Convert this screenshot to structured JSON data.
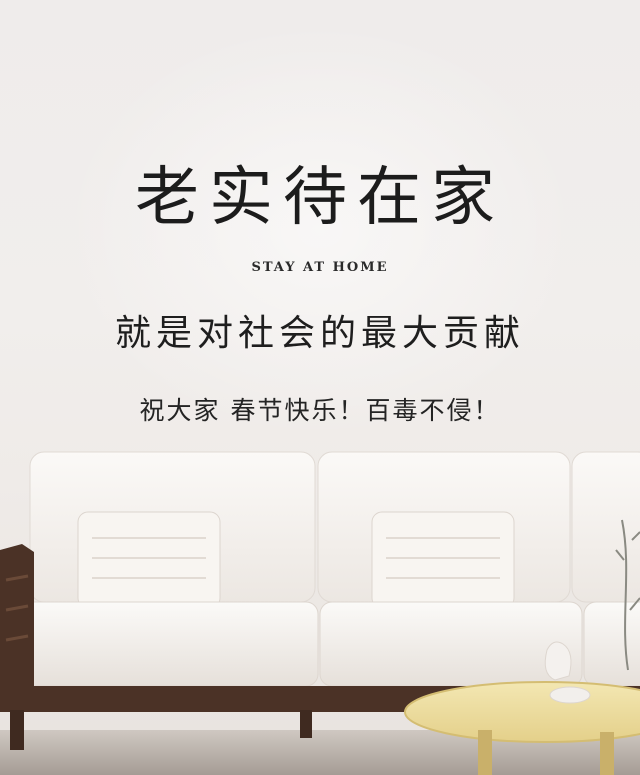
{
  "poster": {
    "headline": "老实待在家",
    "subtitle_en": "STAY AT HOME",
    "slogan": "就是对社会的最大贡献",
    "greeting": "祝大家 春节快乐！百毒不侵！"
  },
  "colors": {
    "wall": "#efecea",
    "text": "#1c1c1c",
    "sofa_frame": "#4b3226",
    "cushion": "#f7f4f1",
    "table_top": "#efe2a8"
  }
}
